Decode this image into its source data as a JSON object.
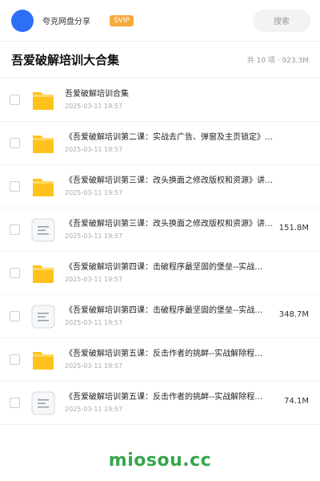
{
  "header": {
    "user_name": "夸克网盘分享",
    "vip_badge": "SVIP",
    "search_placeholder": "搜索"
  },
  "folder": {
    "title": "吾爱破解培训大合集",
    "summary": "共 10 项 · 923.3M"
  },
  "files": [
    {
      "type": "folder",
      "name": "吾爱破解培训合集",
      "date": "2025-03-11 19:57",
      "size": ""
    },
    {
      "type": "folder",
      "name": "《吾爱破解培训第二课：实战去广告、弹窗及主页锁定》…",
      "date": "2025-03-11 19:57",
      "size": ""
    },
    {
      "type": "folder",
      "name": "《吾爱破解培训第三课：改头换面之修改版权和资源》讲…",
      "date": "2025-03-11 19:57",
      "size": ""
    },
    {
      "type": "file",
      "name": "《吾爱破解培训第三课：改头换面之修改版权和资源》讲…",
      "date": "2025-03-11 19:57",
      "size": "151.8M"
    },
    {
      "type": "folder",
      "name": "《吾爱破解培训第四课：击破程序最坚固的堡垒--实战…",
      "date": "2025-03-11 19:57",
      "size": ""
    },
    {
      "type": "file",
      "name": "《吾爱破解培训第四课：击破程序最坚固的堡垒--实战…",
      "date": "2025-03-11 19:57",
      "size": "348.7M"
    },
    {
      "type": "folder",
      "name": "《吾爱破解培训第五课：反击作者的挑衅--实战解除程…",
      "date": "2025-03-11 19:57",
      "size": ""
    },
    {
      "type": "file",
      "name": "《吾爱破解培训第五课：反击作者的挑衅--实战解除程…",
      "date": "2025-03-11 19:57",
      "size": "74.1M"
    }
  ],
  "icons": {
    "folder": "folder-icon",
    "file": "document-icon"
  },
  "colors": {
    "avatar": "#2d6ff6",
    "vip": "#f7a93b",
    "folder": "#ffc21c",
    "watermark": "#35a64a"
  },
  "watermark": "miosou.cc"
}
